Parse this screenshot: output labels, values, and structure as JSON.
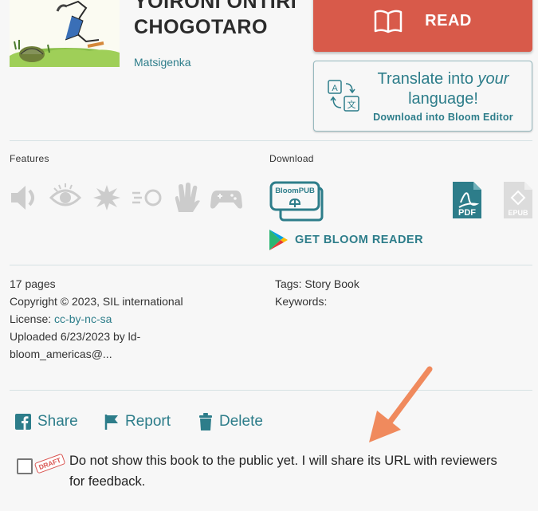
{
  "book": {
    "title_line1": "YOIRONI ONTIRI",
    "title_line2": "CHOGOTARO",
    "language": "Matsigenka"
  },
  "read_button": {
    "label": "READ"
  },
  "translate_button": {
    "text_before": "Translate into ",
    "text_emph": "your",
    "text_after": "language!",
    "sub_label": "Download into Bloom Editor"
  },
  "features": {
    "label": "Features",
    "icons": [
      "talking-book-icon",
      "visually-impaired-icon",
      "activity-icon",
      "quiz-icon",
      "sign-language-icon",
      "game-icon"
    ]
  },
  "download": {
    "label": "Download",
    "bloompub_label": "BloomPUB",
    "pdf_label": "PDF",
    "epub_label": "EPUB",
    "get_reader_label": "GET BLOOM READER"
  },
  "meta": {
    "pages": "17 pages",
    "copyright": "Copyright © 2023, SIL international",
    "license_prefix": "License: ",
    "license": "cc-by-nc-sa",
    "uploaded_line1": "Uploaded 6/23/2023 by ld-",
    "uploaded_line2": "bloom_americas@...",
    "tags": "Tags: Story Book",
    "keywords": "Keywords:"
  },
  "actions": {
    "share": "Share",
    "report": "Report",
    "delete": "Delete"
  },
  "draft": {
    "stamp": "DRAFT",
    "text": "Do not show this book to the public yet. I will share its URL with reviewers for feedback."
  },
  "colors": {
    "accent": "#2d7d8a",
    "read": "#d85a4a",
    "disabled": "#cccccc",
    "arrow": "#f08a5d"
  }
}
